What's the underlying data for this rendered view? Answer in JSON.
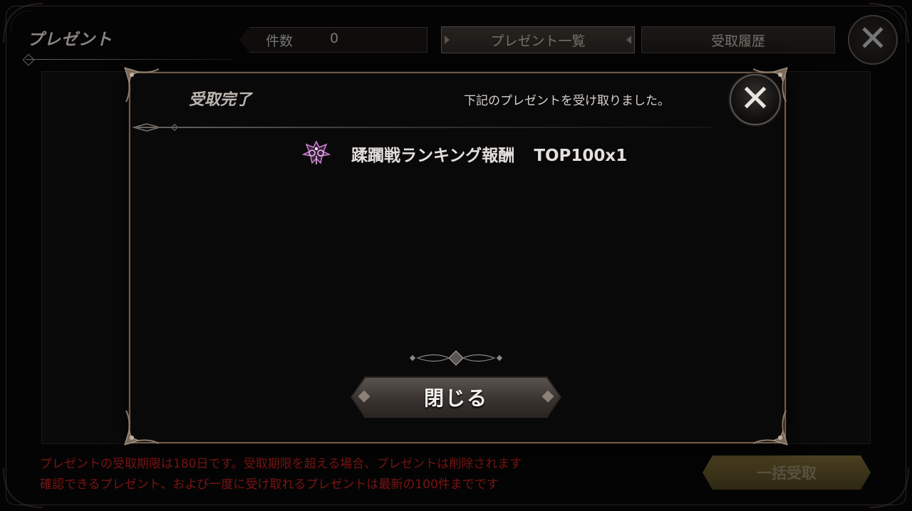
{
  "background": {
    "title": "プレゼント",
    "count_label": "件数",
    "count_value": "0",
    "tab_list": "プレゼント一覧",
    "tab_history": "受取履歴",
    "notice_line1": "プレゼントの受取期限は180日です。受取期限を超える場合、プレゼントは削除されます",
    "notice_line2": "確認できるプレゼント、および一度に受け取れるプレゼントは最新の100件までです",
    "bulk_receive": "一括受取",
    "close_glyph": "✕"
  },
  "modal": {
    "title": "受取完了",
    "message": "下記のプレゼントを受け取りました。",
    "close_glyph": "✕",
    "reward": {
      "icon": "crest-icon",
      "name": "蹂躙戦ランキング報酬",
      "amount": "TOP100x1"
    },
    "close_button": "閉じる"
  },
  "colors": {
    "frame_bronze": "#6e5a4a",
    "notice_red": "#7a1414",
    "reward_icon": "#d080d0"
  }
}
